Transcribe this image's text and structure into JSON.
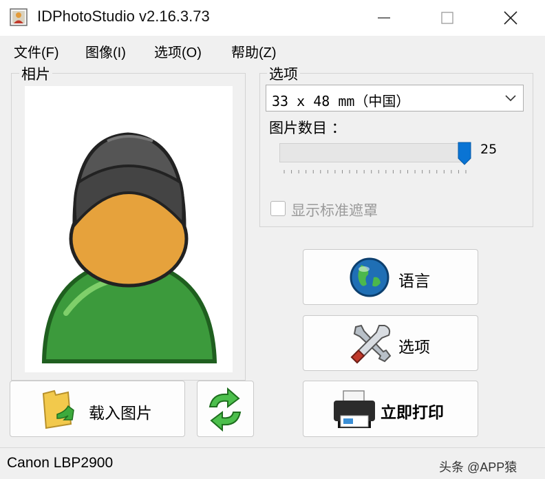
{
  "window": {
    "title": "IDPhotoStudio v2.16.3.73",
    "icon": "app-photo-icon",
    "controls": [
      "minimize-icon",
      "maximize-icon",
      "close-icon"
    ]
  },
  "menu": {
    "items": [
      {
        "label": "文件(F)"
      },
      {
        "label": "图像(I)"
      },
      {
        "label": "选项(O)"
      },
      {
        "label": "帮助(Z)"
      }
    ]
  },
  "photo_group": {
    "label": "相片",
    "placeholder_icon": "person-avatar-icon"
  },
  "options_group": {
    "label": "选项",
    "size_select": {
      "value": "33 x 48 mm（中国）"
    },
    "count_label": "图片数目 ：",
    "count_slider": {
      "value": 25,
      "max": 25,
      "value_text": "25"
    },
    "mask_checkbox": {
      "label": "显示标准遮罩",
      "checked": false,
      "enabled": false
    }
  },
  "buttons": {
    "language": {
      "label": "语言",
      "icon": "globe-icon"
    },
    "options": {
      "label": "选项",
      "icon": "tools-icon"
    },
    "load": {
      "label": "载入图片",
      "icon": "folder-icon"
    },
    "refresh": {
      "icon": "refresh-icon"
    },
    "print": {
      "label": "立即打印",
      "icon": "printer-icon"
    }
  },
  "status": {
    "printer": "Canon LBP2900",
    "watermark": "头条 @APP猿"
  },
  "colors": {
    "window_bg": "#f0f0f0",
    "slider_thumb": "#0a74d4",
    "avatar_body": "#3c9a3c",
    "avatar_face": "#e6a23c"
  }
}
